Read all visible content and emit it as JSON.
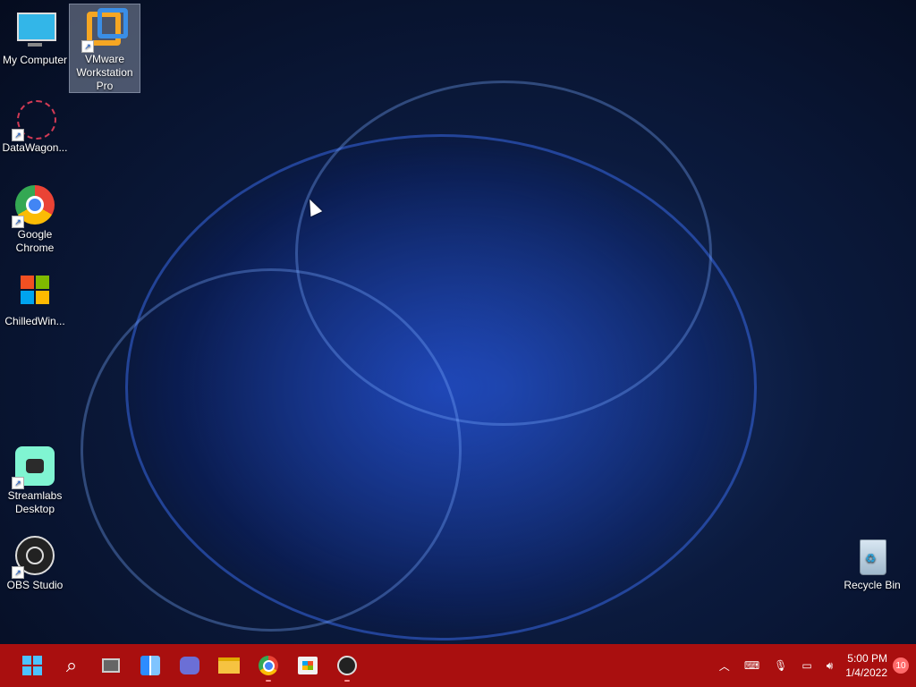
{
  "desktop": {
    "icons": [
      {
        "label": "My Computer",
        "icon": "monitor-icon"
      },
      {
        "label": "VMware Workstation Pro",
        "icon": "vmware-icon"
      },
      {
        "label": "DataWagon...",
        "icon": "datawagon-icon"
      },
      {
        "label": "Google Chrome",
        "icon": "chrome-icon"
      },
      {
        "label": "ChilledWin...",
        "icon": "windows-flag-icon"
      },
      {
        "label": "Streamlabs Desktop",
        "icon": "streamlabs-icon"
      },
      {
        "label": "OBS Studio",
        "icon": "obs-icon"
      },
      {
        "label": "Recycle Bin",
        "icon": "recycle-bin-icon"
      }
    ]
  },
  "taskbar": {
    "items": [
      "start-icon",
      "search-icon",
      "task-view-icon",
      "widgets-icon",
      "teams-chat-icon",
      "file-explorer-icon",
      "chrome-icon",
      "store-icon",
      "obs-icon"
    ]
  },
  "tray": {
    "time": "5:00 PM",
    "date": "1/4/2022",
    "notifications": "10"
  },
  "colors": {
    "taskbar": "#a90f0f",
    "accent": "#1a5fd0"
  }
}
